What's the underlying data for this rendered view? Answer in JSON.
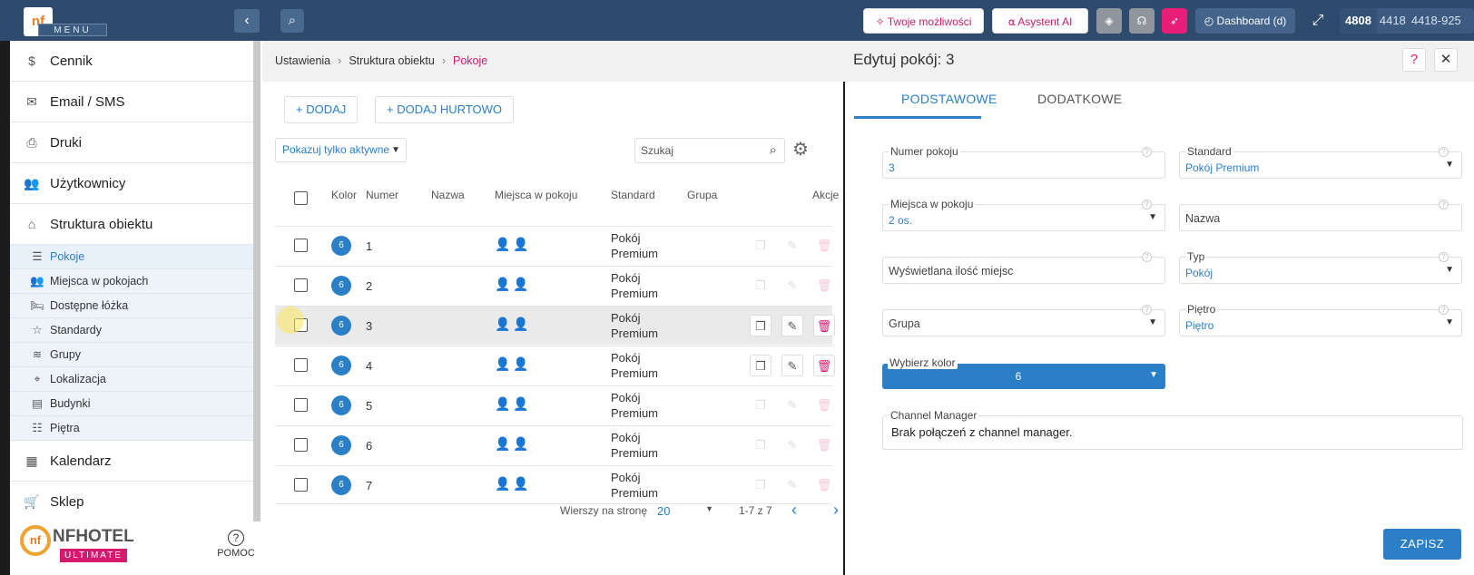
{
  "topbar": {
    "menu_label": "MENU",
    "logo_text": "nf",
    "collapse_icon": "‹",
    "search_icon": "⌕",
    "pills": [
      "Twoje możliwości",
      "Asystent AI",
      "Dashboard (d)"
    ],
    "counter_main": "4808",
    "counter_a": "4418",
    "counter_b": "4418-925"
  },
  "sidebar": {
    "items": [
      {
        "label": "Cennik",
        "icon": "$"
      },
      {
        "label": "Email / SMS",
        "icon": "✉"
      },
      {
        "label": "Druki",
        "icon": "⎙"
      },
      {
        "label": "Użytkownicy",
        "icon": "👥"
      },
      {
        "label": "Struktura obiektu",
        "icon": "⌂"
      }
    ],
    "sub_items": [
      {
        "label": "Pokoje",
        "icon": "☰"
      },
      {
        "label": "Miejsca w pokojach",
        "icon": "👥"
      },
      {
        "label": "Dostępne łóżka",
        "icon": "🛏"
      },
      {
        "label": "Standardy",
        "icon": "☆"
      },
      {
        "label": "Grupy",
        "icon": "≋"
      },
      {
        "label": "Lokalizacja",
        "icon": "⌖"
      },
      {
        "label": "Budynki",
        "icon": "▤"
      },
      {
        "label": "Piętra",
        "icon": "☷"
      }
    ],
    "bottom_items": [
      {
        "label": "Kalendarz",
        "icon": "▦"
      },
      {
        "label": "Sklep",
        "icon": "🛒"
      }
    ],
    "brand_logo": "nf",
    "brand_name": "NFHOTEL",
    "brand_tier": "ULTIMATE",
    "help_label": "POMOC"
  },
  "breadcrumb": [
    "Ustawienia",
    "Struktura obiektu",
    "Pokoje"
  ],
  "rooms": {
    "add_label": "DODAJ",
    "add_bulk_label": "DODAJ HURTOWO",
    "filter_label": "Pokazuj tylko aktywne",
    "search_placeholder": "Szukaj",
    "columns": {
      "color": "Kolor",
      "number": "Numer",
      "name": "Nazwa",
      "places": "Miejsca w pokoju",
      "standard": "Standard",
      "group": "Grupa",
      "actions": "Akcje"
    },
    "rows": [
      {
        "badge": "6",
        "number": "1",
        "std1": "Pokój",
        "std2": "Premium"
      },
      {
        "badge": "6",
        "number": "2",
        "std1": "Pokój",
        "std2": "Premium"
      },
      {
        "badge": "6",
        "number": "3",
        "std1": "Pokój",
        "std2": "Premium"
      },
      {
        "badge": "6",
        "number": "4",
        "std1": "Pokój",
        "std2": "Premium"
      },
      {
        "badge": "6",
        "number": "5",
        "std1": "Pokój",
        "std2": "Premium"
      },
      {
        "badge": "6",
        "number": "6",
        "std1": "Pokój",
        "std2": "Premium"
      },
      {
        "badge": "6",
        "number": "7",
        "std1": "Pokój",
        "std2": "Premium"
      }
    ],
    "rows_per_page_label": "Wierszy na stronę",
    "rows_per_page": "20",
    "range": "1-7 z 7"
  },
  "edit": {
    "title": "Edytuj pokój: 3",
    "help_icon": "?",
    "close_icon": "✕",
    "tabs": [
      "PODSTAWOWE",
      "DODATKOWE"
    ],
    "fields": {
      "room_number_label": "Numer pokoju",
      "room_number": "3",
      "standard_label": "Standard",
      "standard": "Pokój Premium",
      "places_label": "Miejsca w pokoju",
      "places": "2 os.",
      "name_placeholder": "Nazwa",
      "display_places_placeholder": "Wyświetlana ilość miejsc",
      "type_label": "Typ",
      "type": "Pokój",
      "group_placeholder": "Grupa",
      "floor_label": "Piętro",
      "floor": "Piętro",
      "color_label": "Wybierz kolor",
      "color_value": "6",
      "channel_label": "Channel Manager",
      "channel_value": "Brak połączeń z channel manager."
    },
    "save_label": "ZAPISZ"
  },
  "colors": {
    "accent": "#2b7fc7",
    "brand": "#d4196f",
    "topbar": "#2e4b6e"
  }
}
